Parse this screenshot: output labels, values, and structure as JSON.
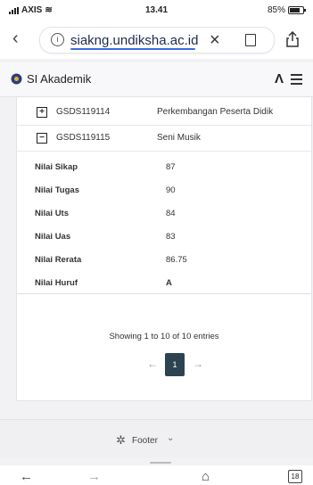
{
  "status_bar": {
    "carrier": "AXIS",
    "time": "13.41",
    "battery": "85%"
  },
  "address_bar": {
    "url": "siakng.undiksha.ac.id"
  },
  "app_header": {
    "title": "SI Akademik"
  },
  "courses": [
    {
      "code": "GSDS119114",
      "name": "Perkembangan Peserta Didik",
      "toggle": "+"
    },
    {
      "code": "GSDS119115",
      "name": "Seni Musik",
      "toggle": "−"
    }
  ],
  "details": [
    {
      "label": "Nilai Sikap",
      "value": "87"
    },
    {
      "label": "Nilai Tugas",
      "value": "90"
    },
    {
      "label": "Nilai Uts",
      "value": "84"
    },
    {
      "label": "Nilai Uas",
      "value": "83"
    },
    {
      "label": "Nilai Rerata",
      "value": "86.75"
    },
    {
      "label": "Nilai Huruf",
      "value": "A"
    }
  ],
  "table_info": "Showing 1 to 10 of 10 entries",
  "pagination": {
    "prev": "←",
    "current": "1",
    "next": "→"
  },
  "footer": {
    "label": "Footer"
  },
  "toolbar": {
    "back": "←",
    "forward": "→",
    "home": "⌂",
    "tab_count": "18"
  }
}
